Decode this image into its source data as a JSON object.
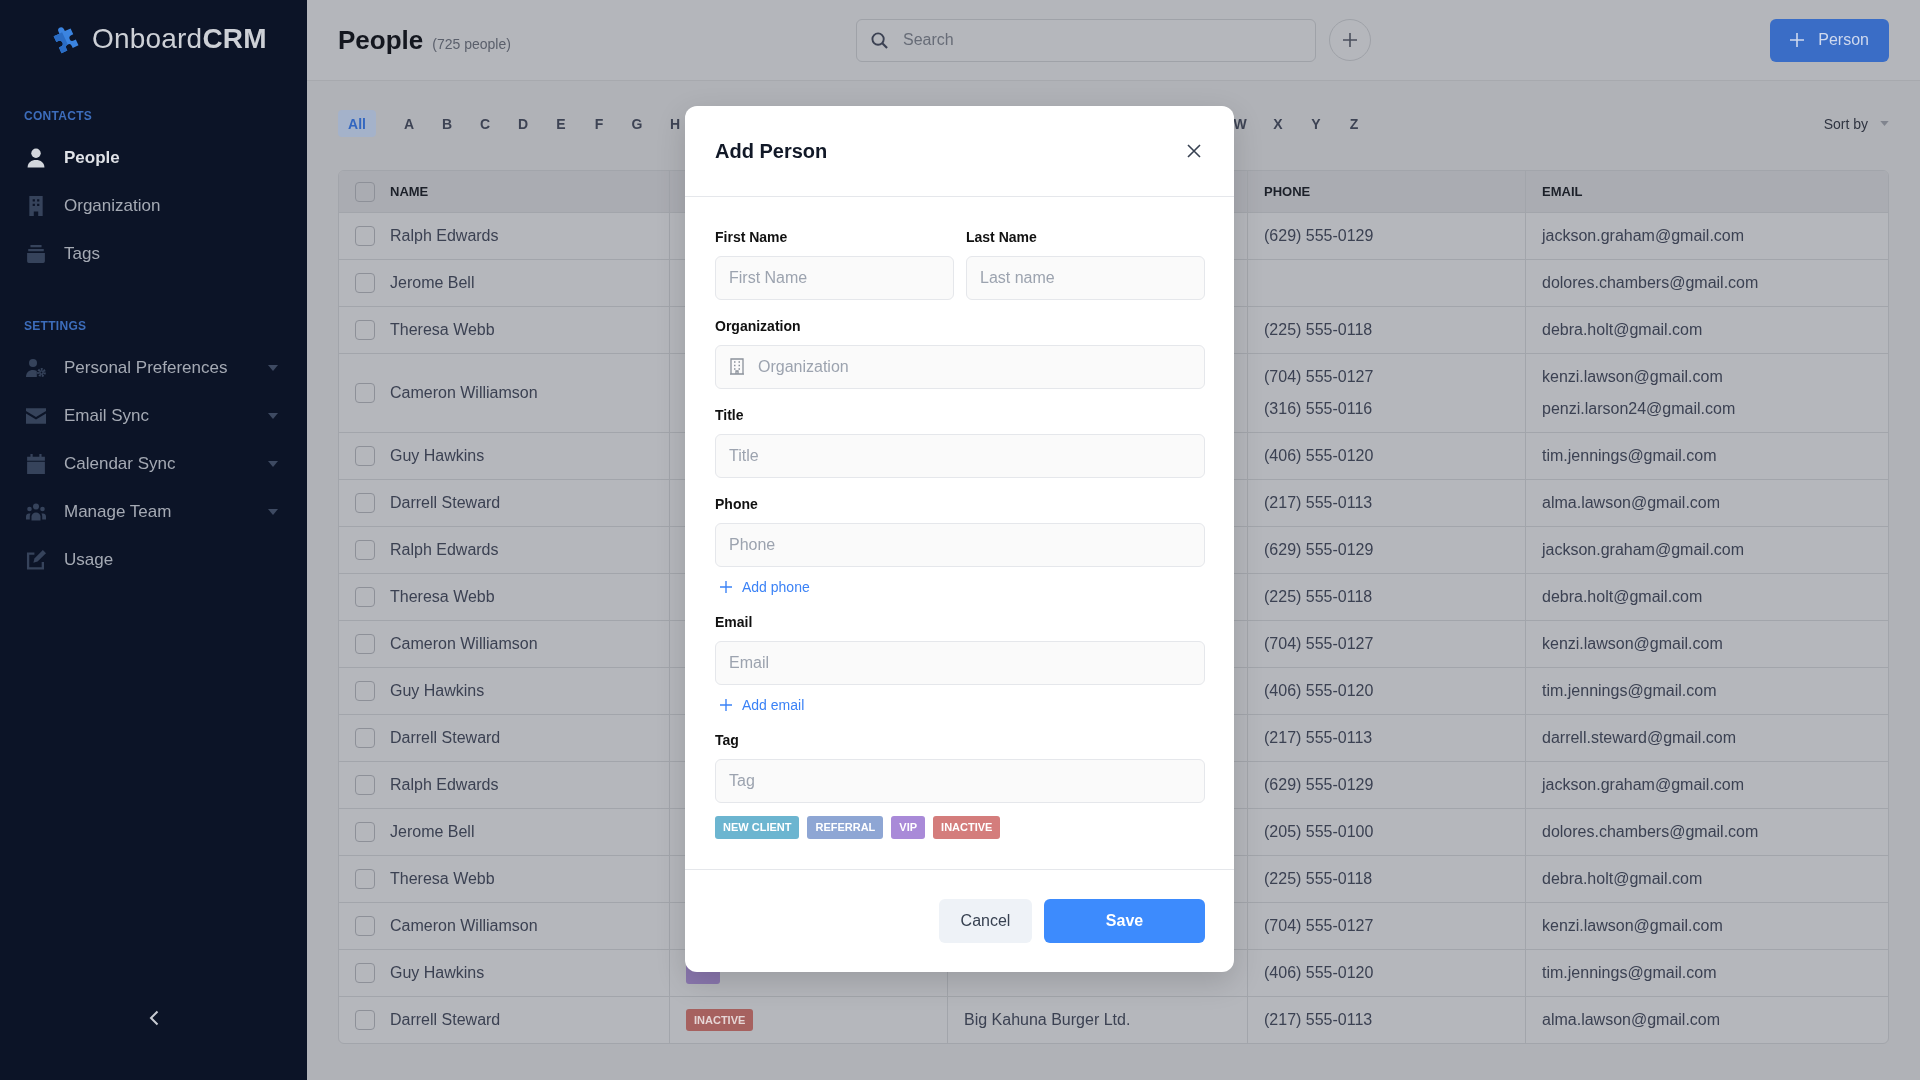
{
  "sidebar": {
    "logo": "Onboard**CRM**",
    "sections": [
      {
        "heading": "CONTACTS",
        "items": [
          {
            "label": "People",
            "kind": "link",
            "selected": true
          },
          {
            "label": "Organization",
            "kind": "link",
            "selected": false
          },
          {
            "label": "Tags",
            "kind": "link",
            "selected": false
          }
        ]
      },
      {
        "heading": "SETTINGS",
        "items": [
          {
            "label": "Personal Preferences",
            "kind": "menu",
            "selected": false
          },
          {
            "label": "Email Sync",
            "kind": "menu",
            "selected": false
          },
          {
            "label": "Calendar Sync",
            "kind": "menu",
            "selected": false
          },
          {
            "label": "Manage Team",
            "kind": "menu",
            "selected": false
          },
          {
            "label": "Usage",
            "kind": "link",
            "selected": false
          }
        ]
      }
    ]
  },
  "header": {
    "title": "People",
    "count": "(725 people)",
    "search": {
      "placeholder": "Search"
    },
    "new_button": {
      "label": "Person"
    }
  },
  "alphabet": {
    "left": [
      {
        "label": "All",
        "selected": true
      },
      {
        "label": "A",
        "selected": false
      },
      {
        "label": "B",
        "selected": false
      },
      {
        "label": "C",
        "selected": false
      },
      {
        "label": "D",
        "selected": false
      },
      {
        "label": "E",
        "selected": false
      },
      {
        "label": "F",
        "selected": false
      },
      {
        "label": "G",
        "selected": false
      },
      {
        "label": "H",
        "selected": false
      }
    ],
    "right": [
      {
        "label": "W",
        "selected": false
      },
      {
        "label": "X",
        "selected": false
      },
      {
        "label": "Y",
        "selected": false
      },
      {
        "label": "Z",
        "selected": false
      }
    ]
  },
  "sort": {
    "label": "Sort by"
  },
  "table": {
    "header_checked": false,
    "columns": {
      "name": "NAME",
      "phone": "PHONE",
      "email": "EMAIL"
    },
    "rows": [
      {
        "name": "Ralph Edwards",
        "checked": false,
        "phones": [
          "(629) 555-0129"
        ],
        "emails": [
          "jackson.graham@gmail.com"
        ]
      },
      {
        "name": "Jerome Bell",
        "checked": false,
        "emails": [
          "dolores.chambers@gmail.com"
        ]
      },
      {
        "name": "Theresa Webb",
        "checked": false,
        "phones": [
          "(225) 555-0118"
        ],
        "emails": [
          "debra.holt@gmail.com"
        ]
      },
      {
        "name": "Cameron Williamson",
        "checked": false,
        "phones": [
          "(704) 555-0127",
          "(316) 555-0116"
        ],
        "emails": [
          "kenzi.lawson@gmail.com",
          "penzi.larson24@gmail.com"
        ]
      },
      {
        "name": "Guy Hawkins",
        "checked": false,
        "phones": [
          "(406) 555-0120"
        ],
        "emails": [
          "tim.jennings@gmail.com"
        ]
      },
      {
        "name": "Darrell Steward",
        "checked": false,
        "phones": [
          "(217) 555-0113"
        ],
        "emails": [
          "alma.lawson@gmail.com"
        ]
      },
      {
        "name": "Ralph Edwards",
        "checked": false,
        "phones": [
          "(629) 555-0129"
        ],
        "emails": [
          "jackson.graham@gmail.com"
        ]
      },
      {
        "name": "Theresa Webb",
        "checked": false,
        "phones": [
          "(225) 555-0118"
        ],
        "emails": [
          "debra.holt@gmail.com"
        ]
      },
      {
        "name": "Cameron Williamson",
        "checked": false,
        "phones": [
          "(704) 555-0127"
        ],
        "emails": [
          "kenzi.lawson@gmail.com"
        ]
      },
      {
        "name": "Guy Hawkins",
        "checked": false,
        "phones": [
          "(406) 555-0120"
        ],
        "emails": [
          "tim.jennings@gmail.com"
        ]
      },
      {
        "name": "Darrell Steward",
        "checked": false,
        "phones": [
          "(217) 555-0113"
        ],
        "emails": [
          "darrell.steward@gmail.com"
        ]
      },
      {
        "name": "Ralph Edwards",
        "checked": false,
        "phones": [
          "(629) 555-0129"
        ],
        "emails": [
          "jackson.graham@gmail.com"
        ]
      },
      {
        "name": "Jerome Bell",
        "checked": false,
        "phones": [
          "(205) 555-0100"
        ],
        "emails": [
          "dolores.chambers@gmail.com"
        ]
      },
      {
        "name": "Theresa Webb",
        "checked": false,
        "phones": [
          "(225) 555-0118"
        ],
        "emails": [
          "debra.holt@gmail.com"
        ]
      },
      {
        "name": "Cameron Williamson",
        "checked": false,
        "phones": [
          "(704) 555-0127"
        ],
        "emails": [
          "kenzi.lawson@gmail.com"
        ]
      },
      {
        "name": "Guy Hawkins",
        "checked": false,
        "tag": {
          "color": "#8a77ae"
        },
        "phones": [
          "(406) 555-0120"
        ],
        "emails": [
          "tim.jennings@gmail.com"
        ]
      },
      {
        "name": "Darrell Steward",
        "checked": false,
        "tag": {
          "label": "INACTIVE",
          "color": "#a6615f"
        },
        "organization": "Big Kahuna Burger Ltd.",
        "phones": [
          "(217) 555-0113"
        ],
        "emails": [
          "alma.lawson@gmail.com"
        ]
      }
    ]
  },
  "modal": {
    "title": "Add Person",
    "name_fields": [
      {
        "label": "First Name",
        "placeholder": "First Name"
      },
      {
        "label": "Last Name",
        "placeholder": "Last name"
      }
    ],
    "fields": [
      {
        "label": "Organization",
        "placeholder": "Organization",
        "kind": "icon"
      },
      {
        "label": "Title",
        "placeholder": "Title",
        "kind": "plain"
      },
      {
        "label": "Phone",
        "placeholder": "Phone",
        "kind": "plain",
        "add_link": "Add phone"
      },
      {
        "label": "Email",
        "placeholder": "Email",
        "kind": "plain",
        "add_link": "Add email"
      },
      {
        "label": "Tag",
        "placeholder": "Tag",
        "kind": "plain"
      }
    ],
    "tags": [
      {
        "label": "NEW CLIENT",
        "color": "#6cb5d0"
      },
      {
        "label": "REFERRAL",
        "color": "#8ea6d4"
      },
      {
        "label": "VIP",
        "color": "#a98ad8"
      },
      {
        "label": "INACTIVE",
        "color": "#d47d7c"
      }
    ],
    "actions": [
      {
        "label": "Cancel",
        "kind": "secondary"
      },
      {
        "label": "Save",
        "kind": "primary"
      }
    ]
  }
}
